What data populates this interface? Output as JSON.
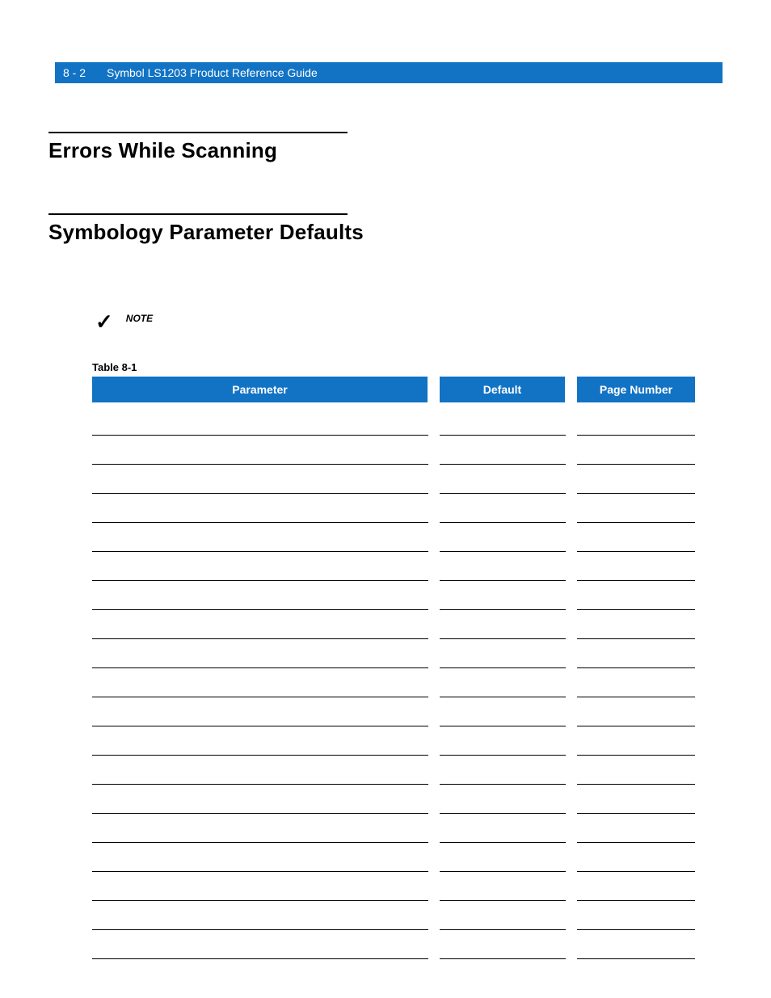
{
  "header": {
    "page_number": "8 - 2",
    "title": "Symbol LS1203 Product Reference Guide"
  },
  "sections": {
    "s1_title": "Errors While Scanning",
    "s2_title": "Symbology Parameter Defaults"
  },
  "note": {
    "icon": "✓",
    "label": "NOTE"
  },
  "table": {
    "caption": "Table 8-1",
    "columns": {
      "parameter": "Parameter",
      "default": "Default",
      "page_number": "Page Number"
    },
    "row_count": 19
  }
}
